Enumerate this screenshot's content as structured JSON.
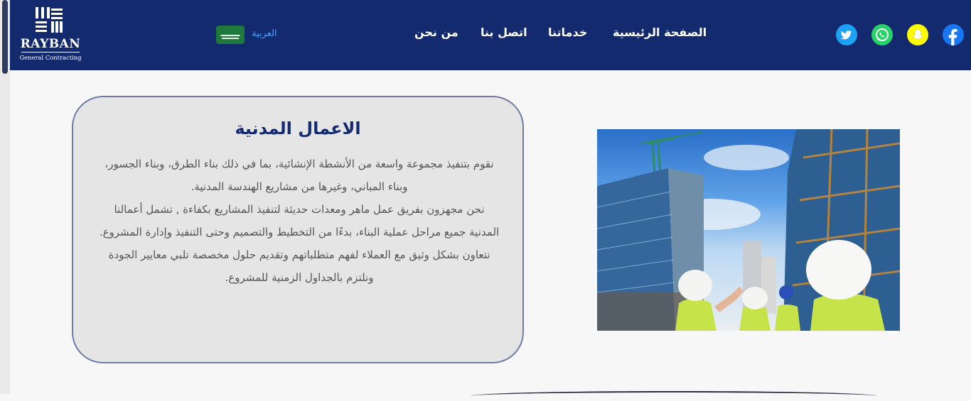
{
  "header": {
    "logo": {
      "name": "RAYBAN",
      "tagline": "General Contracting"
    },
    "language": {
      "label": "العربية",
      "flag_icon": "saudi-flag-icon"
    },
    "nav": {
      "home": "الصفحة الرئيسية",
      "services": "خدماتنا",
      "contact": "اتصل بنا",
      "about": "من نحن"
    },
    "social": [
      {
        "name": "twitter",
        "icon": "twitter-icon",
        "color": "#1da1f2"
      },
      {
        "name": "whatsapp",
        "icon": "whatsapp-icon",
        "color": "#25d366"
      },
      {
        "name": "snapchat",
        "icon": "snapchat-icon",
        "color": "#fffc00"
      },
      {
        "name": "facebook",
        "icon": "facebook-icon",
        "color": "#1877f2"
      }
    ],
    "background": "#132a6f"
  },
  "section": {
    "title": "الاعمال المدنية",
    "lines": [
      "نقوم بتنفيذ مجموعة واسعة من الأنشطة الإنشائية، بما في ذلك بناء الطرق، وبناء الجسور،",
      "وبناء المباني، وغيرها من مشاريع الهندسة المدنية.",
      "نحن مجهزون بفريق عمل ماهر ومعدات حديثة لتنفيذ المشاريع بكفاءة , تشمل أعمالنا",
      "المدنية جميع مراحل عملية البناء، بدءًا من التخطيط والتصميم وحتى التنفيذ وإدارة المشروع.",
      "نتعاون بشكل وثيق مع العملاء لفهم متطلباتهم وتقديم حلول مخصصة تلبي معايير الجودة",
      "ونلتزم بالجداول الزمنية للمشروع."
    ],
    "image": "construction-site-photo",
    "title_color": "#132a6f"
  }
}
